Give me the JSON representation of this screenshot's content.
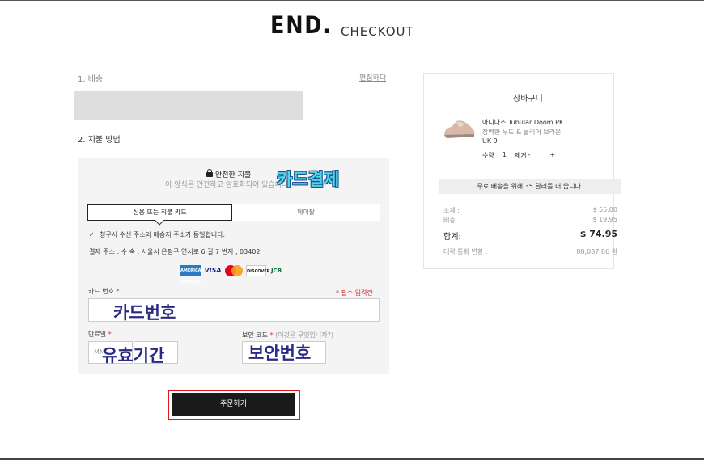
{
  "header": {
    "logo": "END.",
    "subtitle": "CHECKOUT"
  },
  "shipping": {
    "step_label": "1. 배송",
    "edit_link": "편집하다"
  },
  "payment": {
    "step_label": "2. 지불 방법",
    "secure_title": "안전한 지불",
    "secure_sub": "이 양식은 안전하고 암호화되어 있습니다.",
    "tabs": {
      "card": "신용 또는 직불 카드",
      "paypal": "페이팔"
    },
    "billing_same": "청구서 수신 주소와 배송지 주소가 동일합니다.",
    "billing_address": "결제 주소 : 수 숙 , 서울시 은평구 연서로 6 길 7 번지 , 03402",
    "card_icons": [
      "amex-icon",
      "visa-icon",
      "mastercard-icon",
      "discover-icon",
      "jcb-icon"
    ],
    "card_brand_labels": {
      "amex": "AMERICAN EXPRESS",
      "visa": "VISA",
      "discover": "DISCOVER",
      "jcb": "JCB"
    },
    "card_number_label": "카드 번호",
    "required_marker": "*",
    "required_note": "* 필수 입력란",
    "expiry_label": "만료일",
    "expiry_placeholder": "MM",
    "cvv_label": "보안 코드",
    "cvv_hint": "(이것은 무엇입니까?)",
    "order_button": "주문하기"
  },
  "annotations": {
    "card_payment": "카드결제",
    "card_number": "카드번호",
    "expiry": "유효기간",
    "security_code": "보안번호"
  },
  "cart": {
    "title": "장바구니",
    "product": {
      "name": "아디다스 Tubular Doom PK",
      "color": "창백한 누드 & 클리어 브라운",
      "size": "UK 9",
      "qty_label": "수량",
      "qty": "1",
      "remove": "제거",
      "minus": "-",
      "plus": "+"
    },
    "free_shipping": "무료 배송을 위해 35 달러를 더 씁니다.",
    "subtotal_label": "소계 :",
    "subtotal": "$ 55.00",
    "shipping_label": "배송",
    "shipping": "$ 19.95",
    "total_label": "합계:",
    "total": "$ 74.95",
    "converted_label": "대략 통화 변환 :",
    "converted": "88,087.86 원"
  },
  "colors": {
    "accent_red": "#e0151c",
    "button_dark": "#1a1a1a",
    "annotation_navy": "#2a2a86",
    "annotation_cyan": "#4fd3e6"
  }
}
